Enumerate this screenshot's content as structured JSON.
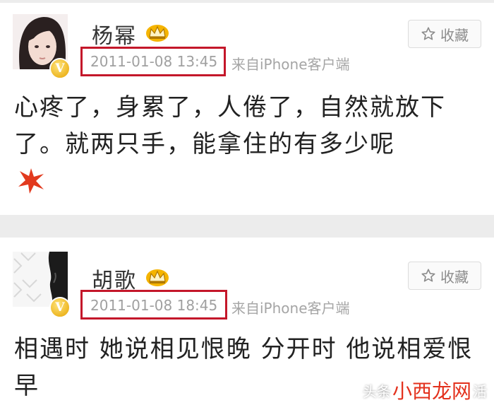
{
  "posts": [
    {
      "author": "杨幂",
      "timestamp": "2011-01-08 13:45",
      "source": "来自iPhone客户端",
      "favorite_label": "收藏",
      "text": "心疼了，身累了，人倦了，自然就放下了。就两只手，能拿住的有多少呢",
      "badge": "V"
    },
    {
      "author": "胡歌",
      "timestamp": "2011-01-08 18:45",
      "source": "来自iPhone客户端",
      "favorite_label": "收藏",
      "text": "相遇时 她说相见恨晚 分开时 他说相爱恨早",
      "badge": "V"
    }
  ],
  "watermark": {
    "prefix": "头条",
    "logo_text": "小西龙网",
    "suffix": "活"
  },
  "colors": {
    "highlight_box": "#c4172a",
    "badge_gold": "#e6a400",
    "background": "#ececec"
  }
}
